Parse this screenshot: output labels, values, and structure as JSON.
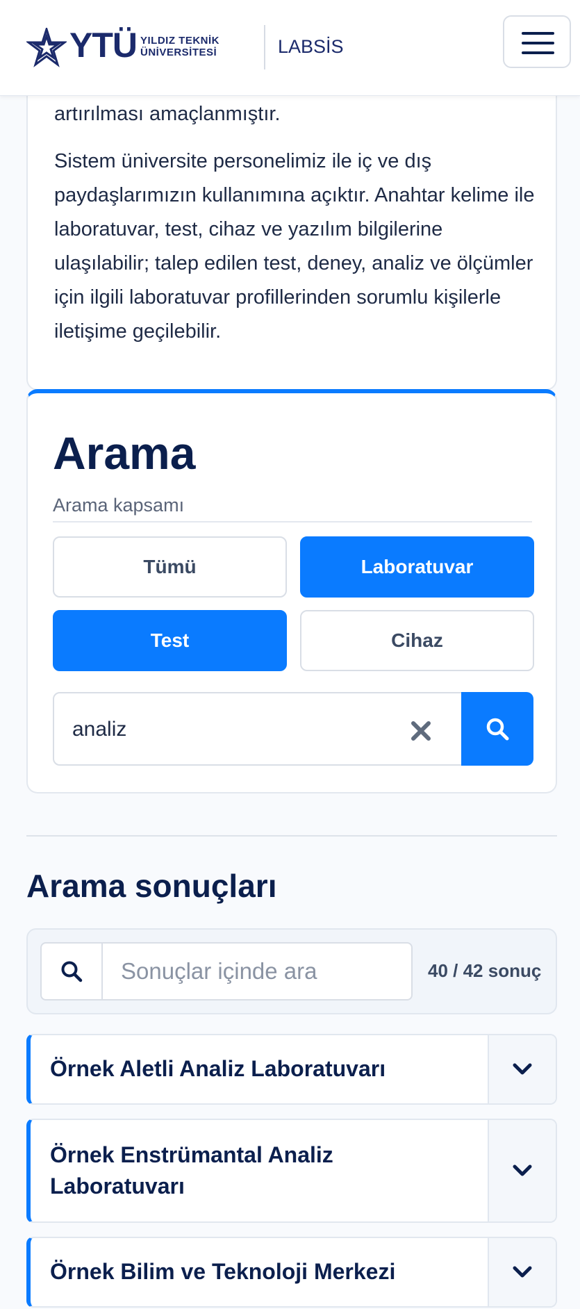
{
  "header": {
    "logo_text": "YTÜ",
    "logo_sub_line1": "YILDIZ TEKNİK",
    "logo_sub_line2": "ÜNİVERSİTESİ",
    "app_name": "LABSİS",
    "menu_icon": "hamburger-icon"
  },
  "intro": {
    "paragraph_tail": "artırılması amaçlanmıştır.",
    "paragraph2": "Sistem üniversite personelimiz ile iç ve dış paydaşlarımızın kullanımına açıktır. Anahtar kelime ile laboratuvar, test, cihaz ve yazılım bilgilerine ulaşılabilir; talep edilen test, deney, analiz ve ölçümler için ilgili laboratuvar profillerinden sorumlu kişilerle iletişime geçilebilir."
  },
  "search": {
    "title": "Arama",
    "scope_label": "Arama kapsamı",
    "scopes": [
      {
        "label": "Tümü",
        "selected": false
      },
      {
        "label": "Laboratuvar",
        "selected": true
      },
      {
        "label": "Test",
        "selected": true
      },
      {
        "label": "Cihaz",
        "selected": false
      }
    ],
    "query": "analiz",
    "clear_icon": "close-icon",
    "submit_icon": "search-icon"
  },
  "results": {
    "title": "Arama sonuçları",
    "filter_placeholder": "Sonuçlar içinde ara",
    "count_text": "40 / 42 sonuç",
    "items": [
      {
        "title": "Örnek Aletli Analiz Laboratuvarı"
      },
      {
        "title": "Örnek Enstrümantal Analiz Laboratuvarı"
      },
      {
        "title": "Örnek Bilim ve Teknoloji Merkezi"
      }
    ]
  },
  "colors": {
    "accent": "#0a7bff",
    "navy": "#0b1f4d",
    "border": "#e3e8ef"
  }
}
